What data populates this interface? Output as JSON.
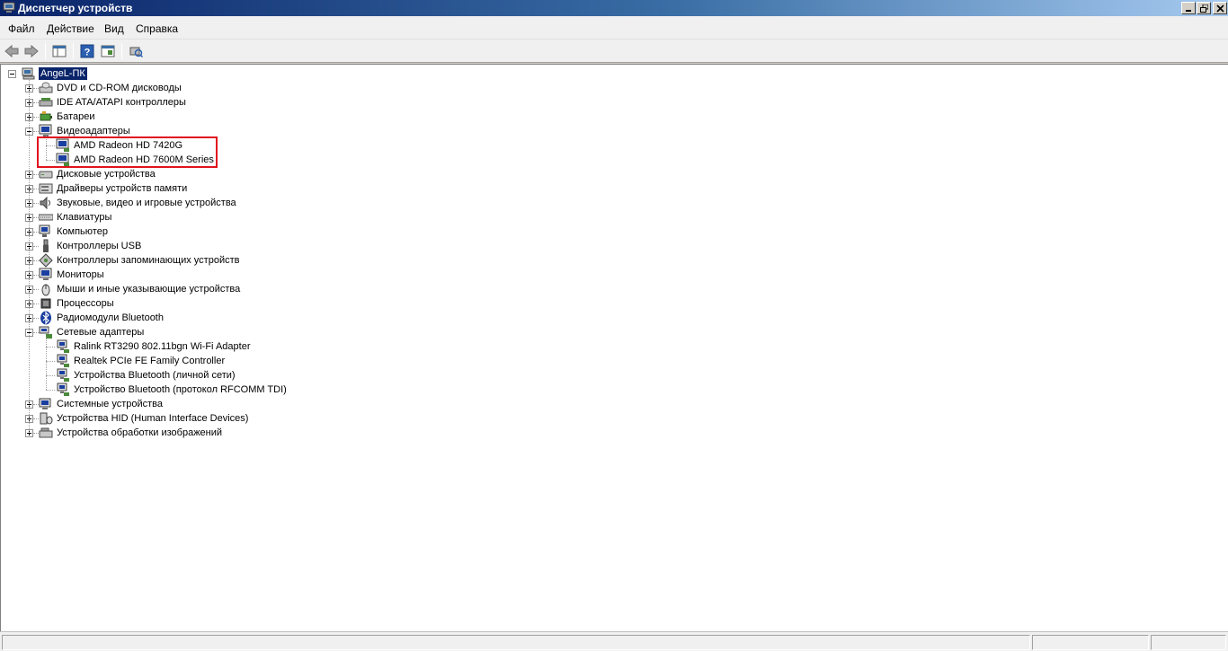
{
  "window": {
    "title": "Диспетчер устройств"
  },
  "menu": [
    {
      "label": "Файл"
    },
    {
      "label": "Действие"
    },
    {
      "label": "Вид"
    },
    {
      "label": "Справка"
    }
  ],
  "toolbar": {
    "buttons": [
      {
        "icon": "back-arrow-icon"
      },
      {
        "icon": "forward-arrow-icon"
      },
      {
        "icon": "show-hide-console-tree-icon"
      },
      {
        "icon": "help-icon"
      },
      {
        "icon": "properties-pane-icon"
      },
      {
        "icon": "scan-hardware-icon"
      }
    ]
  },
  "tree": {
    "root": "AngeL-ПК",
    "categories": [
      {
        "label": "DVD и CD-ROM дисководы",
        "icon": "dvd-drive-icon",
        "expanded": false
      },
      {
        "label": "IDE ATA/ATAPI контроллеры",
        "icon": "ide-controller-icon",
        "expanded": false
      },
      {
        "label": "Батареи",
        "icon": "battery-icon",
        "expanded": false
      },
      {
        "label": "Видеоадаптеры",
        "icon": "display-adapter-icon",
        "expanded": true,
        "children": [
          "AMD Radeon HD 7420G",
          "AMD Radeon HD 7600M Series"
        ]
      },
      {
        "label": "Дисковые устройства",
        "icon": "disk-drive-icon",
        "expanded": false
      },
      {
        "label": "Драйверы устройств памяти",
        "icon": "memory-device-icon",
        "expanded": false
      },
      {
        "label": "Звуковые, видео и игровые устройства",
        "icon": "sound-icon",
        "expanded": false
      },
      {
        "label": "Клавиатуры",
        "icon": "keyboard-icon",
        "expanded": false
      },
      {
        "label": "Компьютер",
        "icon": "computer-icon",
        "expanded": false
      },
      {
        "label": "Контроллеры USB",
        "icon": "usb-icon",
        "expanded": false
      },
      {
        "label": "Контроллеры запоминающих устройств",
        "icon": "storage-controller-icon",
        "expanded": false
      },
      {
        "label": "Мониторы",
        "icon": "monitor-icon",
        "expanded": false
      },
      {
        "label": "Мыши и иные указывающие устройства",
        "icon": "mouse-icon",
        "expanded": false
      },
      {
        "label": "Процессоры",
        "icon": "processor-icon",
        "expanded": false
      },
      {
        "label": "Радиомодули Bluetooth",
        "icon": "bluetooth-icon",
        "expanded": false
      },
      {
        "label": "Сетевые адаптеры",
        "icon": "network-adapter-icon",
        "expanded": true,
        "children": [
          "Ralink RT3290 802.11bgn Wi-Fi Adapter",
          "Realtek PCIe FE Family Controller",
          "Устройства Bluetooth (личной сети)",
          "Устройство Bluetooth (протокол RFCOMM TDI)"
        ]
      },
      {
        "label": "Системные устройства",
        "icon": "system-device-icon",
        "expanded": false
      },
      {
        "label": "Устройства HID (Human Interface Devices)",
        "icon": "hid-icon",
        "expanded": false
      },
      {
        "label": "Устройства обработки изображений",
        "icon": "imaging-device-icon",
        "expanded": false
      }
    ]
  },
  "colors": {
    "selection": "#0a246a",
    "highlight_box": "#e0141e"
  }
}
